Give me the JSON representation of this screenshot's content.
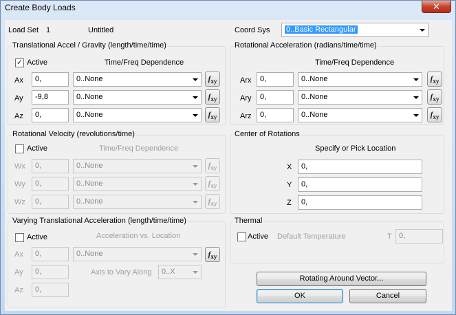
{
  "window": {
    "title": "Create Body Loads",
    "close_label": "✕"
  },
  "header": {
    "load_set_label": "Load Set",
    "load_set_id": "1",
    "load_set_name": "Untitled",
    "coord_sys_label": "Coord Sys",
    "coord_sys_value": "0..Basic Rectangular"
  },
  "translational": {
    "title": "Translational Accel / Gravity  (length/time/time)",
    "active_label": "Active",
    "active_checked": true,
    "dependence_label": "Time/Freq Dependence",
    "rows": [
      {
        "label": "Ax",
        "value": "0,",
        "dependence": "0..None"
      },
      {
        "label": "Ay",
        "value": "-9,8",
        "dependence": "0..None"
      },
      {
        "label": "Az",
        "value": "0,",
        "dependence": "0..None"
      }
    ]
  },
  "rotational_accel": {
    "title": "Rotational Acceleration (radians/time/time)",
    "dependence_label": "Time/Freq Dependence",
    "rows": [
      {
        "label": "Arx",
        "value": "0,",
        "dependence": "0..None"
      },
      {
        "label": "Ary",
        "value": "0,",
        "dependence": "0..None"
      },
      {
        "label": "Arz",
        "value": "0,",
        "dependence": "0..None"
      }
    ]
  },
  "rotational_velocity": {
    "title": "Rotational Velocity (revolutions/time)",
    "active_label": "Active",
    "active_checked": false,
    "dependence_label": "Time/Freq Dependence",
    "rows": [
      {
        "label": "Wx",
        "value": "0,",
        "dependence": "0..None"
      },
      {
        "label": "Wy",
        "value": "0,",
        "dependence": "0..None"
      },
      {
        "label": "Wz",
        "value": "0,",
        "dependence": "0..None"
      }
    ]
  },
  "center": {
    "title": "Center of Rotations",
    "subtitle": "Specify or Pick Location",
    "rows": [
      {
        "label": "X",
        "value": "0,"
      },
      {
        "label": "Y",
        "value": "0,"
      },
      {
        "label": "Z",
        "value": "0,"
      }
    ]
  },
  "varying": {
    "title": "Varying Translational Acceleration  (length/time/time)",
    "active_label": "Active",
    "active_checked": false,
    "accel_vs_location_label": "Acceleration vs. Location",
    "axis_label": "Axis to Vary Along",
    "axis_value": "0..X",
    "dependence": "0..None",
    "rows": [
      {
        "label": "Ax",
        "value": "0,"
      },
      {
        "label": "Ay",
        "value": "0,"
      },
      {
        "label": "Az",
        "value": "0,"
      }
    ]
  },
  "thermal": {
    "title": "Thermal",
    "active_label": "Active",
    "active_checked": false,
    "default_temp_label": "Default Temperature",
    "t_label": "T",
    "t_value": "0,"
  },
  "buttons": {
    "rotating_vector": "Rotating Around Vector...",
    "ok": "OK",
    "cancel": "Cancel"
  },
  "icons": {
    "fxy_main": "f",
    "fxy_sub": "xy"
  }
}
